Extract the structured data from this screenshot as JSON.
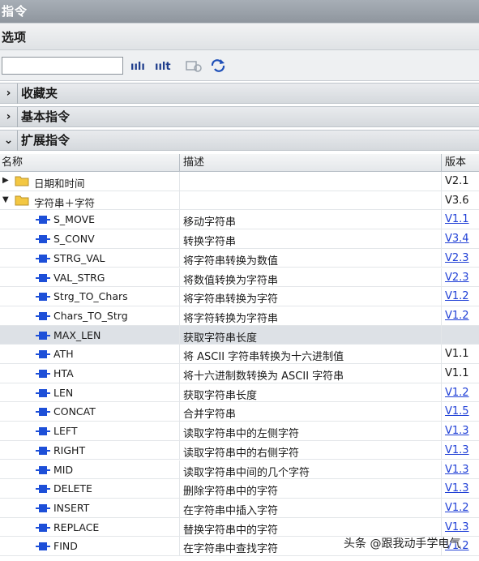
{
  "window": {
    "title": "指令"
  },
  "options": {
    "title": "选项"
  },
  "search": {
    "value": "",
    "placeholder": ""
  },
  "sections": [
    {
      "arrow": "›",
      "label": "收藏夹",
      "expanded": false
    },
    {
      "arrow": "›",
      "label": "基本指令",
      "expanded": false
    },
    {
      "arrow": "⌄",
      "label": "扩展指令",
      "expanded": true
    }
  ],
  "columns": {
    "name": "名称",
    "description": "描述",
    "version": "版本"
  },
  "folders": [
    {
      "name": "日期和时间",
      "version": "V2.1",
      "expanded": false
    },
    {
      "name": "字符串＋字符",
      "version": "V3.6",
      "expanded": true
    }
  ],
  "instructions": [
    {
      "name": "S_MOVE",
      "desc": "移动字符串",
      "version": "V1.1",
      "link": true
    },
    {
      "name": "S_CONV",
      "desc": "转换字符串",
      "version": "V3.4",
      "link": true
    },
    {
      "name": "STRG_VAL",
      "desc": "将字符串转换为数值",
      "version": "V2.3",
      "link": true
    },
    {
      "name": "VAL_STRG",
      "desc": "将数值转换为字符串",
      "version": "V2.3",
      "link": true
    },
    {
      "name": "Strg_TO_Chars",
      "desc": "将字符串转换为字符",
      "version": "V1.2",
      "link": true
    },
    {
      "name": "Chars_TO_Strg",
      "desc": "将字符转换为字符串",
      "version": "V1.2",
      "link": true
    },
    {
      "name": "MAX_LEN",
      "desc": "获取字符串长度",
      "version": "",
      "link": false,
      "selected": true
    },
    {
      "name": "ATH",
      "desc": "将 ASCII 字符串转换为十六进制值",
      "version": "V1.1",
      "link": false
    },
    {
      "name": "HTA",
      "desc": "将十六进制数转换为 ASCII 字符串",
      "version": "V1.1",
      "link": false
    },
    {
      "name": "LEN",
      "desc": "获取字符串长度",
      "version": "V1.2",
      "link": true
    },
    {
      "name": "CONCAT",
      "desc": "合并字符串",
      "version": "V1.5",
      "link": true
    },
    {
      "name": "LEFT",
      "desc": "读取字符串中的左侧字符",
      "version": "V1.3",
      "link": true
    },
    {
      "name": "RIGHT",
      "desc": "读取字符串中的右侧字符",
      "version": "V1.3",
      "link": true
    },
    {
      "name": "MID",
      "desc": "读取字符串中间的几个字符",
      "version": "V1.3",
      "link": true
    },
    {
      "name": "DELETE",
      "desc": "删除字符串中的字符",
      "version": "V1.3",
      "link": true
    },
    {
      "name": "INSERT",
      "desc": "在字符串中插入字符",
      "version": "V1.2",
      "link": true
    },
    {
      "name": "REPLACE",
      "desc": "替换字符串中的字符",
      "version": "V1.3",
      "link": true
    },
    {
      "name": "FIND",
      "desc": "在字符串中查找字符",
      "version": "V1.2",
      "link": true
    }
  ],
  "watermark": "头条 @跟我动手学电气",
  "colors": {
    "link": "#1f3fd6",
    "folder": "#f3c742",
    "block": "#1d4fd8"
  }
}
